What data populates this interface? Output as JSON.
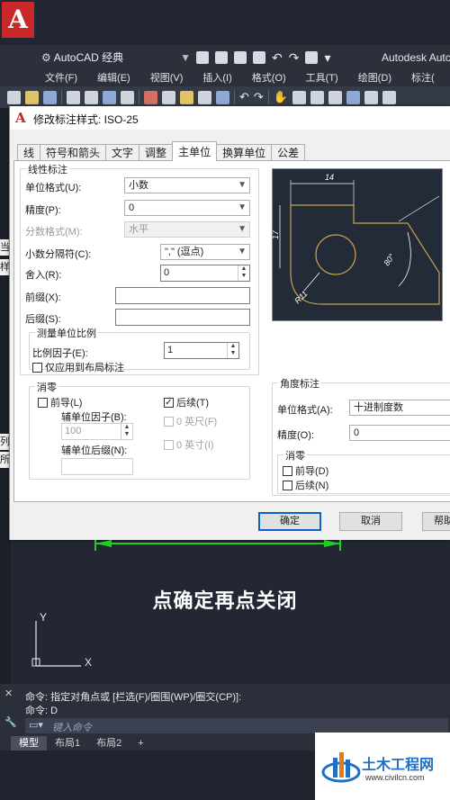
{
  "app": {
    "workspace": "AutoCAD 经典",
    "brand": "Autodesk Autc",
    "menu": [
      "文件(F)",
      "编辑(E)",
      "视图(V)",
      "插入(I)",
      "格式(O)",
      "工具(T)",
      "绘图(D)",
      "标注("
    ]
  },
  "dialog": {
    "title": "修改标注样式: ISO-25",
    "tabs": [
      "线",
      "符号和箭头",
      "文字",
      "调整",
      "主单位",
      "换算单位",
      "公差"
    ],
    "active_tab": "主单位",
    "linear": {
      "title": "线性标注",
      "unit_format_label": "单位格式(U):",
      "unit_format_value": "小数",
      "precision_label": "精度(P):",
      "precision_value": "0",
      "fraction_label": "分数格式(M):",
      "fraction_value": "水平",
      "decimal_sep_label": "小数分隔符(C):",
      "decimal_sep_value": "\",\"  (逗点)",
      "roundoff_label": "舍入(R):",
      "roundoff_value": "0",
      "prefix_label": "前缀(X):",
      "prefix_value": "",
      "suffix_label": "后缀(S):",
      "suffix_value": ""
    },
    "scale": {
      "title": "测量单位比例",
      "factor_label": "比例因子(E):",
      "factor_value": "1",
      "layout_only_label": "仅应用到布局标注"
    },
    "zero_linear": {
      "title": "消零",
      "leading_label": "前导(L)",
      "trailing_label": "后续(T)",
      "sub_factor_label": "辅单位因子(B):",
      "sub_factor_value": "100",
      "sub_suffix_label": "辅单位后缀(N):",
      "sub_suffix_value": "",
      "feet_label": "0 英尺(F)",
      "inches_label": "0 英寸(I)"
    },
    "angular": {
      "title": "角度标注",
      "unit_format_label": "单位格式(A):",
      "unit_format_value": "十进制度数",
      "precision_label": "精度(O):",
      "precision_value": "0",
      "zero_title": "消零",
      "leading_label": "前导(D)",
      "trailing_label": "后续(N)"
    },
    "preview": {
      "dim_top": "14",
      "dim_left": "17",
      "dim_angle": "80°",
      "dim_radius": "R11"
    },
    "buttons": {
      "ok": "确定",
      "cancel": "取消",
      "help": "帮助"
    }
  },
  "caption": "点确定再点关闭",
  "ucs": {
    "y": "Y",
    "x": "X"
  },
  "command": {
    "line1": "命令: 指定对角点或 [栏选(F)/圈围(WP)/圈交(CP)]:",
    "line2": "命令: D",
    "placeholder": "键入命令"
  },
  "layout_tabs": [
    "模型",
    "布局1",
    "布局2",
    "+"
  ],
  "watermark": {
    "name": "土木工程网",
    "url": "www.civilcn.com"
  },
  "edge_fragments": [
    "当",
    "样",
    "列",
    "所"
  ],
  "colors": {
    "accent": "#0a64c8",
    "autocad_red": "#c8282a",
    "preview_line": "#c9a24a",
    "dim_green": "#20d020"
  }
}
